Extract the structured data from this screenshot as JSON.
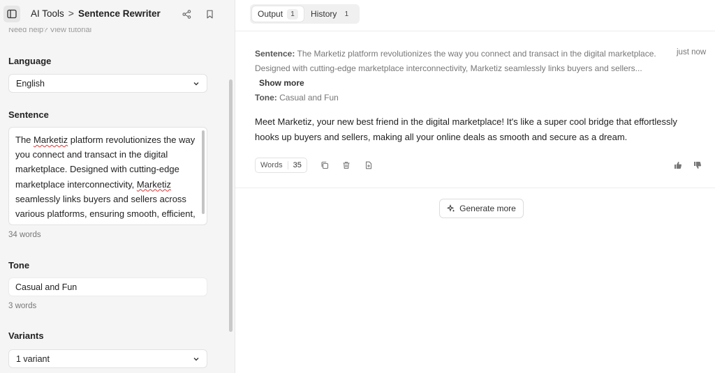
{
  "header": {
    "breadcrumb_parent": "AI Tools",
    "breadcrumb_separator": ">",
    "breadcrumb_current": "Sentence Rewriter"
  },
  "sidebar": {
    "tutorial_text": "Need help? View tutorial",
    "language": {
      "label": "Language",
      "value": "English"
    },
    "sentence": {
      "label": "Sentence",
      "value_parts": [
        "The ",
        "Marketiz",
        " platform revolutionizes the way you connect and transact in the digital marketplace. Designed with cutting-edge marketplace interconnectivity, ",
        "Marketiz",
        " seamlessly links buyers and sellers across various platforms, ensuring smooth, efficient, and secure transactions."
      ],
      "word_count": "34 words"
    },
    "tone": {
      "label": "Tone",
      "value": "Casual and Fun",
      "word_count": "3 words"
    },
    "variants": {
      "label": "Variants",
      "value": "1 variant"
    }
  },
  "tabs": [
    {
      "label": "Output",
      "count": "1",
      "active": true
    },
    {
      "label": "History",
      "count": "1",
      "active": false
    }
  ],
  "result": {
    "sentence_label": "Sentence:",
    "sentence_preview": "The Marketiz platform revolutionizes the way you connect and transact in the digital marketplace. Designed with cutting-edge marketplace interconnectivity, Marketiz seamlessly links buyers and sellers...",
    "show_more": "Show more",
    "tone_label": "Tone:",
    "tone_value": "Casual and Fun",
    "timestamp": "just now",
    "output_text": "Meet Marketiz, your new best friend in the digital marketplace! It's like a super cool bridge that effortlessly hooks up buyers and sellers, making all your online deals as smooth and secure as a dream.",
    "words_label": "Words",
    "words_count": "35"
  },
  "generate_more_label": "Generate more",
  "icons": [
    "sidebar-toggle-icon",
    "chevron-right-icon",
    "share-icon",
    "bookmark-icon",
    "chevron-down-icon",
    "copy-icon",
    "trash-icon",
    "export-icon",
    "thumbs-up-icon",
    "thumbs-down-icon",
    "sparkle-icon"
  ]
}
